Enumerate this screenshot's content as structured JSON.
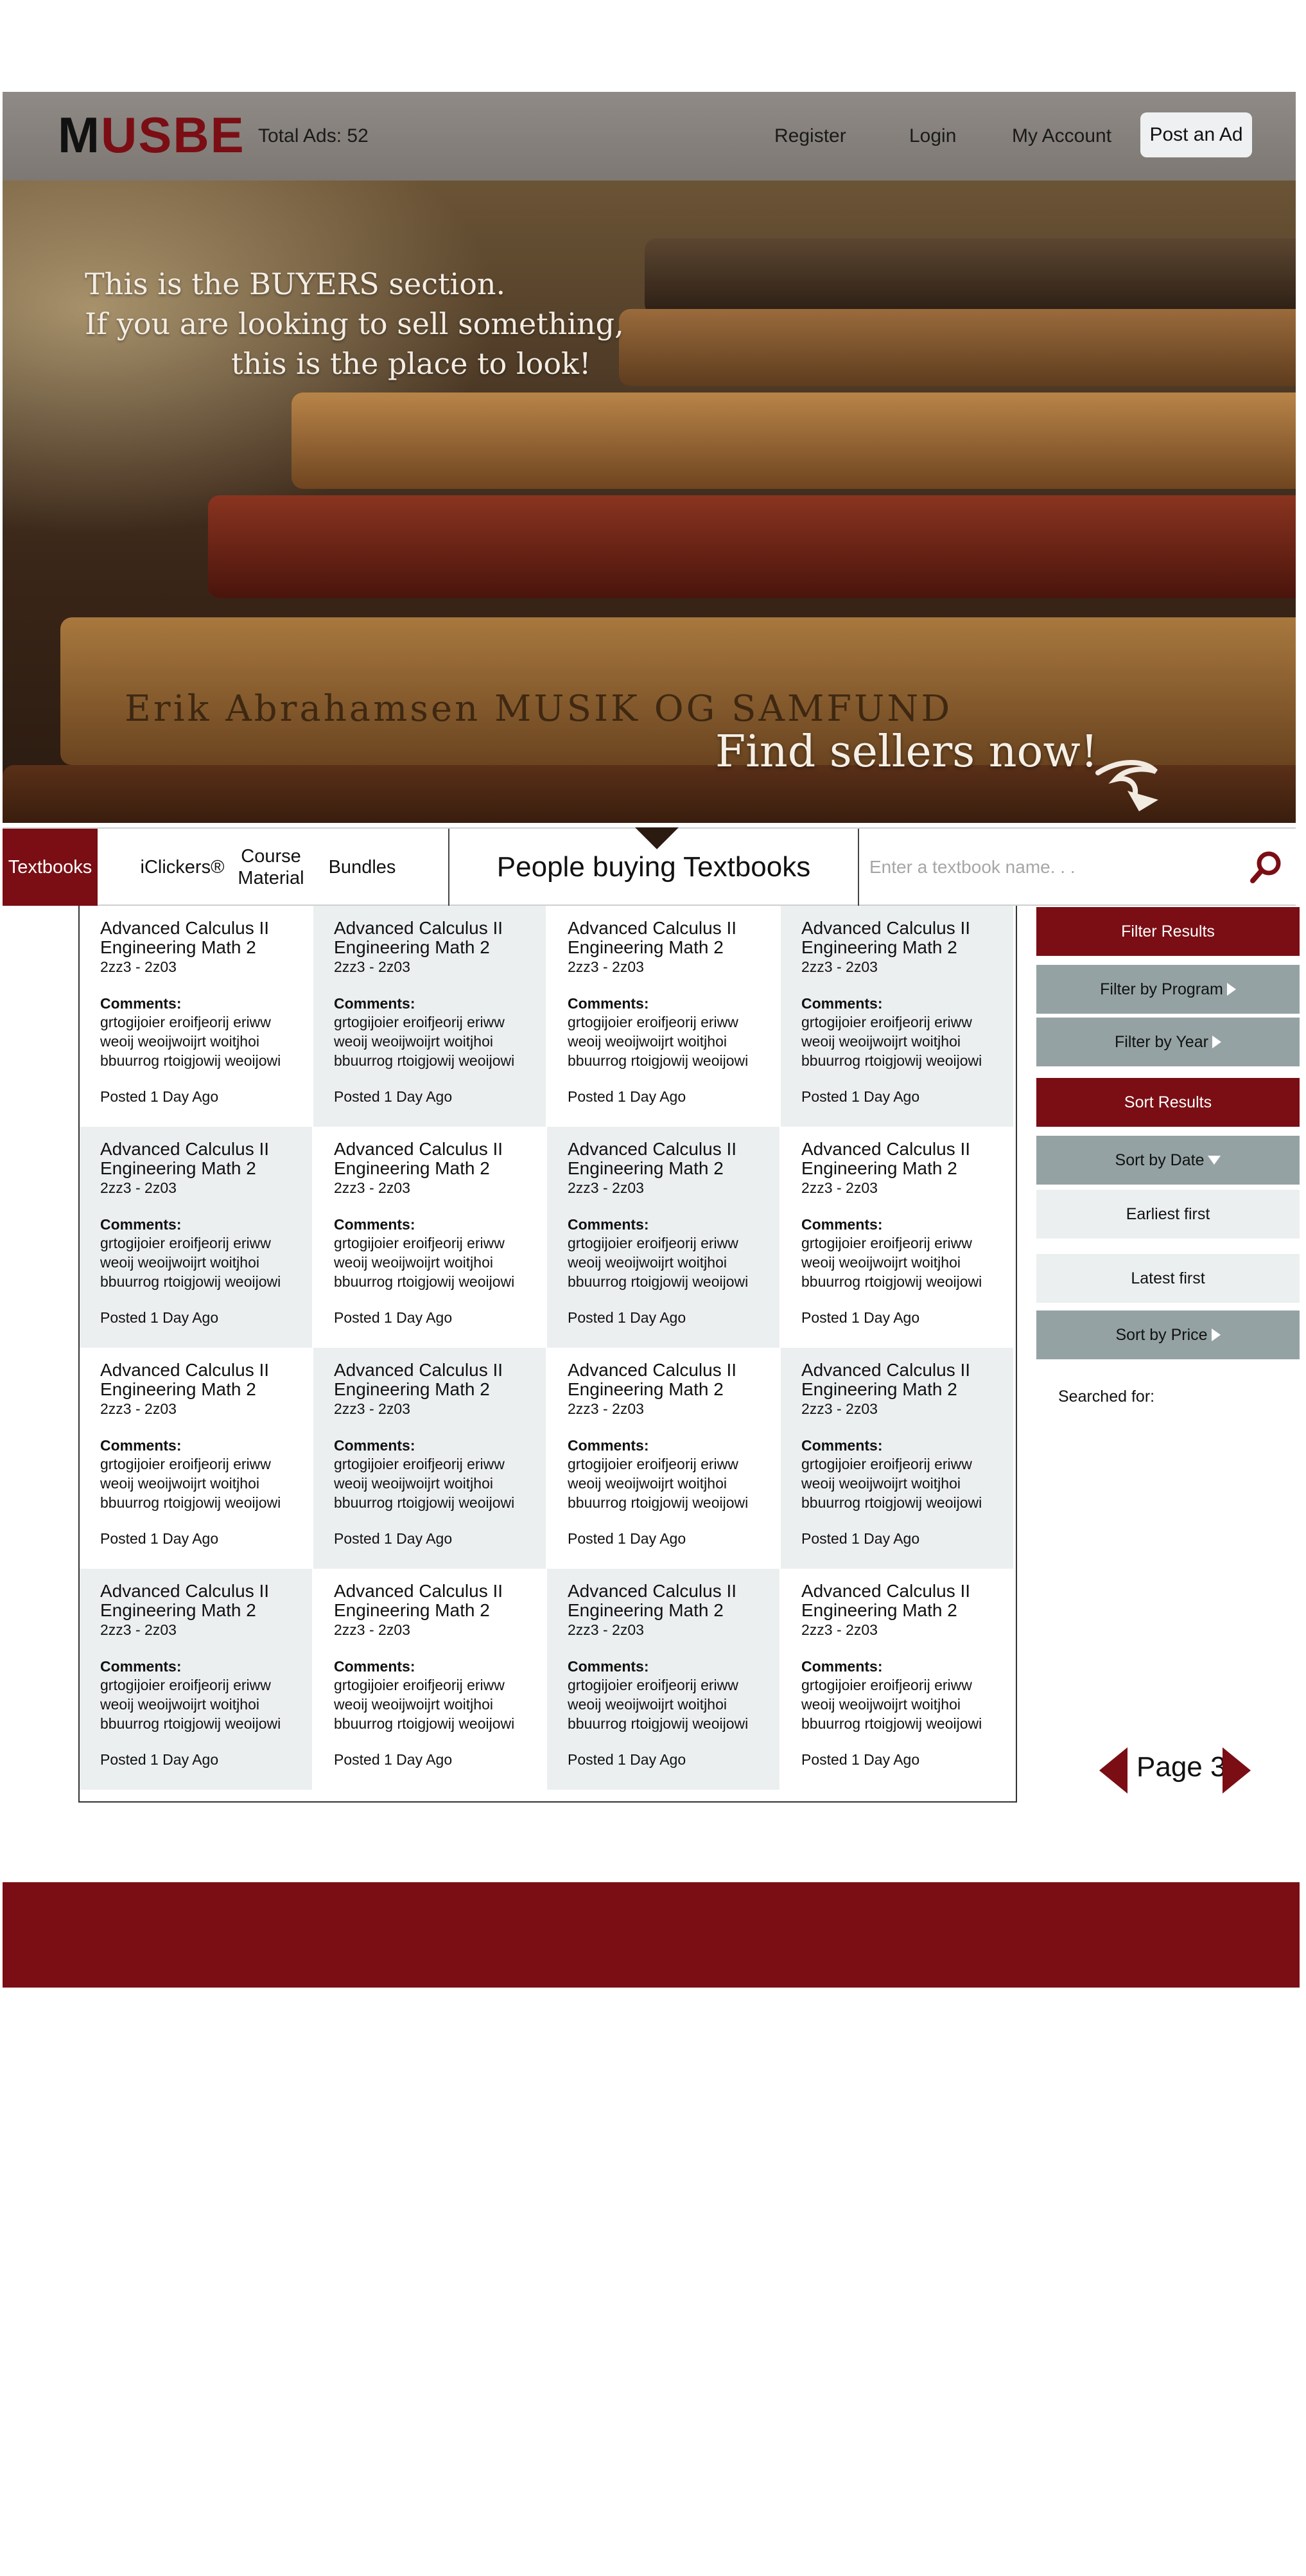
{
  "header": {
    "logo_first": "M",
    "logo_rest": "USBE",
    "total_ads": "Total Ads: 52",
    "nav": {
      "register": "Register",
      "login": "Login",
      "my_account": "My Account",
      "post_ad": "Post an Ad"
    }
  },
  "hero": {
    "line1": "This is the BUYERS section.",
    "line2": "If you are looking to sell something,",
    "line3": "this is the place to look!",
    "cta": "Find sellers now!",
    "spine_text": "Erik Abrahamsen  MUSIK OG SAMFUND"
  },
  "categories": {
    "textbooks": "Textbooks",
    "iclickers": "iClickers®",
    "course_material": "Course Material",
    "bundles": "Bundles",
    "section_title": "People buying Textbooks",
    "search_placeholder": "Enter a textbook name. . ."
  },
  "listings": [
    {
      "title1": "Advanced Calculus II",
      "title2": "Engineering Math 2",
      "code": "2zz3 - 2z03",
      "comments_label": "Comments:",
      "comment_lines": [
        "grtogijoier eroifjeorij eriww",
        "weoij weoijwoijrt woitjhoi",
        "bbuurrog rtoigjowij weoijowi"
      ],
      "posted": "Posted 1 Day Ago"
    },
    {
      "title1": "Advanced Calculus II",
      "title2": "Engineering Math 2",
      "code": "2zz3 - 2z03",
      "comments_label": "Comments:",
      "comment_lines": [
        "grtogijoier eroifjeorij eriww",
        "weoij weoijwoijrt woitjhoi",
        "bbuurrog rtoigjowij weoijowi"
      ],
      "posted": "Posted 1 Day Ago"
    },
    {
      "title1": "Advanced Calculus II",
      "title2": "Engineering Math 2",
      "code": "2zz3 - 2z03",
      "comments_label": "Comments:",
      "comment_lines": [
        "grtogijoier eroifjeorij eriww",
        "weoij weoijwoijrt woitjhoi",
        "bbuurrog rtoigjowij weoijowi"
      ],
      "posted": "Posted 1 Day Ago"
    },
    {
      "title1": "Advanced Calculus II",
      "title2": "Engineering Math 2",
      "code": "2zz3 - 2z03",
      "comments_label": "Comments:",
      "comment_lines": [
        "grtogijoier eroifjeorij eriww",
        "weoij weoijwoijrt woitjhoi",
        "bbuurrog rtoigjowij weoijowi"
      ],
      "posted": "Posted 1 Day Ago"
    },
    {
      "title1": "Advanced Calculus II",
      "title2": "Engineering Math 2",
      "code": "2zz3 - 2z03",
      "comments_label": "Comments:",
      "comment_lines": [
        "grtogijoier eroifjeorij eriww",
        "weoij weoijwoijrt woitjhoi",
        "bbuurrog rtoigjowij weoijowi"
      ],
      "posted": "Posted 1 Day Ago"
    },
    {
      "title1": "Advanced Calculus II",
      "title2": "Engineering Math 2",
      "code": "2zz3 - 2z03",
      "comments_label": "Comments:",
      "comment_lines": [
        "grtogijoier eroifjeorij eriww",
        "weoij weoijwoijrt woitjhoi",
        "bbuurrog rtoigjowij weoijowi"
      ],
      "posted": "Posted 1 Day Ago"
    },
    {
      "title1": "Advanced Calculus II",
      "title2": "Engineering Math 2",
      "code": "2zz3 - 2z03",
      "comments_label": "Comments:",
      "comment_lines": [
        "grtogijoier eroifjeorij eriww",
        "weoij weoijwoijrt woitjhoi",
        "bbuurrog rtoigjowij weoijowi"
      ],
      "posted": "Posted 1 Day Ago"
    },
    {
      "title1": "Advanced Calculus II",
      "title2": "Engineering Math 2",
      "code": "2zz3 - 2z03",
      "comments_label": "Comments:",
      "comment_lines": [
        "grtogijoier eroifjeorij eriww",
        "weoij weoijwoijrt woitjhoi",
        "bbuurrog rtoigjowij weoijowi"
      ],
      "posted": "Posted 1 Day Ago"
    },
    {
      "title1": "Advanced Calculus II",
      "title2": "Engineering Math 2",
      "code": "2zz3 - 2z03",
      "comments_label": "Comments:",
      "comment_lines": [
        "grtogijoier eroifjeorij eriww",
        "weoij weoijwoijrt woitjhoi",
        "bbuurrog rtoigjowij weoijowi"
      ],
      "posted": "Posted 1 Day Ago"
    },
    {
      "title1": "Advanced Calculus II",
      "title2": "Engineering Math 2",
      "code": "2zz3 - 2z03",
      "comments_label": "Comments:",
      "comment_lines": [
        "grtogijoier eroifjeorij eriww",
        "weoij weoijwoijrt woitjhoi",
        "bbuurrog rtoigjowij weoijowi"
      ],
      "posted": "Posted 1 Day Ago"
    },
    {
      "title1": "Advanced Calculus II",
      "title2": "Engineering Math 2",
      "code": "2zz3 - 2z03",
      "comments_label": "Comments:",
      "comment_lines": [
        "grtogijoier eroifjeorij eriww",
        "weoij weoijwoijrt woitjhoi",
        "bbuurrog rtoigjowij weoijowi"
      ],
      "posted": "Posted 1 Day Ago"
    },
    {
      "title1": "Advanced Calculus II",
      "title2": "Engineering Math 2",
      "code": "2zz3 - 2z03",
      "comments_label": "Comments:",
      "comment_lines": [
        "grtogijoier eroifjeorij eriww",
        "weoij weoijwoijrt woitjhoi",
        "bbuurrog rtoigjowij weoijowi"
      ],
      "posted": "Posted 1 Day Ago"
    },
    {
      "title1": "Advanced Calculus II",
      "title2": "Engineering Math 2",
      "code": "2zz3 - 2z03",
      "comments_label": "Comments:",
      "comment_lines": [
        "grtogijoier eroifjeorij eriww",
        "weoij weoijwoijrt woitjhoi",
        "bbuurrog rtoigjowij weoijowi"
      ],
      "posted": "Posted 1 Day Ago"
    },
    {
      "title1": "Advanced Calculus II",
      "title2": "Engineering Math 2",
      "code": "2zz3 - 2z03",
      "comments_label": "Comments:",
      "comment_lines": [
        "grtogijoier eroifjeorij eriww",
        "weoij weoijwoijrt woitjhoi",
        "bbuurrog rtoigjowij weoijowi"
      ],
      "posted": "Posted 1 Day Ago"
    },
    {
      "title1": "Advanced Calculus II",
      "title2": "Engineering Math 2",
      "code": "2zz3 - 2z03",
      "comments_label": "Comments:",
      "comment_lines": [
        "grtogijoier eroifjeorij eriww",
        "weoij weoijwoijrt woitjhoi",
        "bbuurrog rtoigjowij weoijowi"
      ],
      "posted": "Posted 1 Day Ago"
    },
    {
      "title1": "Advanced Calculus II",
      "title2": "Engineering Math 2",
      "code": "2zz3 - 2z03",
      "comments_label": "Comments:",
      "comment_lines": [
        "grtogijoier eroifjeorij eriww",
        "weoij weoijwoijrt woitjhoi",
        "bbuurrog rtoigjowij weoijowi"
      ],
      "posted": "Posted 1 Day Ago"
    }
  ],
  "sidebar": {
    "filter_results": "Filter Results",
    "filter_by_program": "Filter by Program",
    "filter_by_year": "Filter by Year",
    "sort_results": "Sort Results",
    "sort_by_date": "Sort by Date",
    "earliest_first": "Earliest first",
    "latest_first": "Latest first",
    "sort_by_price": "Sort by Price",
    "searched_for": "Searched for:"
  },
  "pagination": {
    "label": "Page 3"
  },
  "colors": {
    "brand": "#7a0e14",
    "header_bg": "#8a8580",
    "sidebar_grey": "#94a2a3",
    "card_shade": "#eceff0"
  },
  "icons": {
    "search": "search-icon",
    "prev": "chevron-left-icon",
    "next": "chevron-right-icon",
    "cta_arrow": "swoosh-arrow-icon"
  }
}
